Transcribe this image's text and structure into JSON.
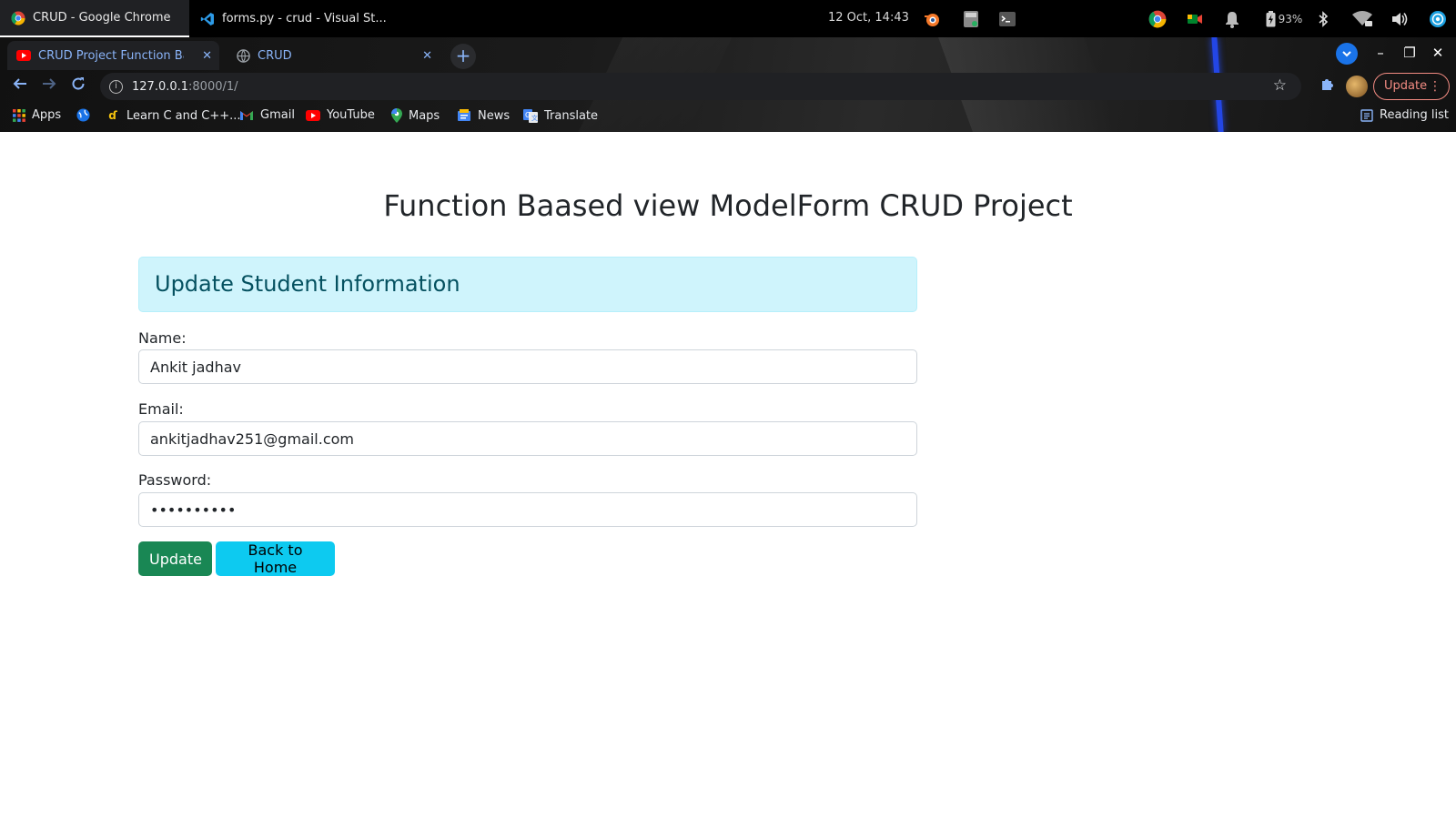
{
  "taskbar": {
    "windows": [
      {
        "title": "CRUD - Google Chrome",
        "icon": "chrome-icon",
        "active": true
      },
      {
        "title": "forms.py - crud - Visual St...",
        "icon": "vscode-icon",
        "active": false
      }
    ],
    "clock": "12 Oct, 14:43",
    "battery": "93%"
  },
  "browser": {
    "tabs": [
      {
        "title": "CRUD Project Function Based",
        "icon": "youtube-icon",
        "active": true
      },
      {
        "title": "CRUD",
        "icon": "globe-icon",
        "active": false
      }
    ],
    "new_tab_label": "+",
    "url": {
      "host": "127.0.0.1",
      "path": ":8000/1/"
    },
    "update_label": "Update",
    "bookmarks": [
      {
        "label": "Apps",
        "icon": "apps-grid-icon"
      },
      {
        "label": "",
        "icon": "globe-icon"
      },
      {
        "label": "Learn C and C++...",
        "icon": "learn-c-icon"
      },
      {
        "label": "Gmail",
        "icon": "gmail-icon"
      },
      {
        "label": "YouTube",
        "icon": "youtube-icon"
      },
      {
        "label": "Maps",
        "icon": "maps-pin-icon"
      },
      {
        "label": "News",
        "icon": "news-icon"
      },
      {
        "label": "Translate",
        "icon": "translate-icon"
      }
    ],
    "reading_list": "Reading list"
  },
  "page": {
    "title": "Function Baased view ModelForm CRUD Project",
    "alert_heading": "Update Student Information",
    "form": {
      "name_label": "Name:",
      "name_value": "Ankit jadhav",
      "email_label": "Email:",
      "email_value": "ankitjadhav251@gmail.com",
      "password_label": "Password:",
      "password_value": "••••••••••"
    },
    "buttons": {
      "update": "Update",
      "back": "Back to Home"
    }
  },
  "colors": {
    "success": "#198754",
    "info": "#0dcaf0",
    "alert_bg": "#cff4fc",
    "alert_text": "#055160",
    "tab_text": "#8ab4f8",
    "update_pill": "#f28b82"
  }
}
